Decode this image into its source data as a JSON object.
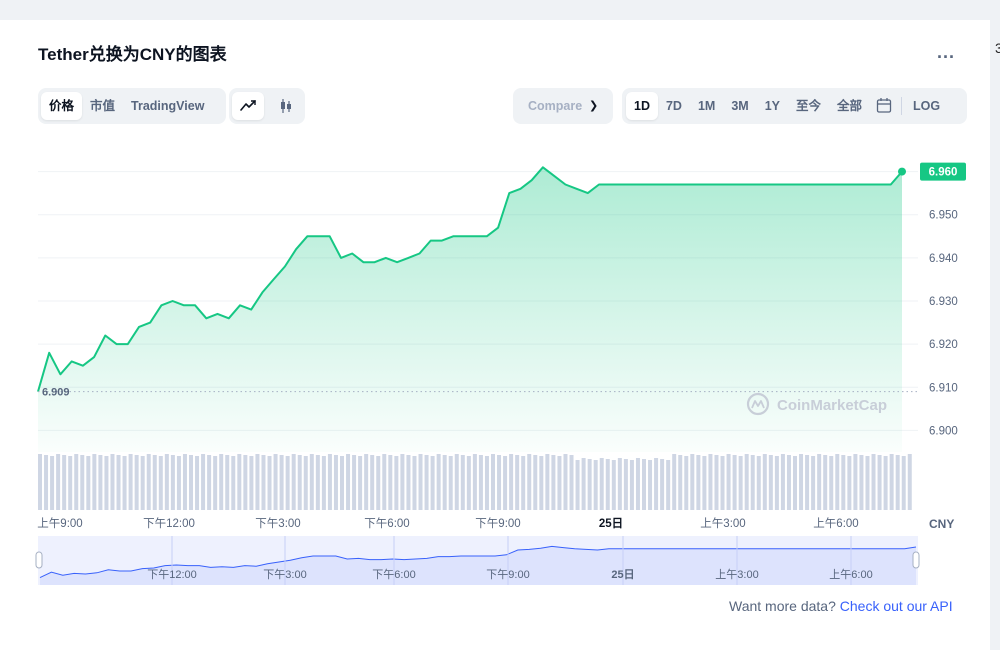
{
  "header": {
    "title": "Tether兑换为CNY的图表",
    "more_label": "...",
    "edge_label": "3"
  },
  "toolbar": {
    "view_tabs": [
      "价格",
      "市值",
      "TradingView"
    ],
    "chart_type": [
      "line-chart-icon",
      "candlestick-icon"
    ],
    "compare_label": "Compare",
    "ranges": [
      "1D",
      "7D",
      "1M",
      "3M",
      "1Y",
      "至今",
      "全部"
    ],
    "calendar_icon": "calendar-icon",
    "log_label": "LOG"
  },
  "watermark": "CoinMarketCap",
  "footer": {
    "prefix": "Want more data? ",
    "link": "Check out our API"
  },
  "colors": {
    "line": "#16c784",
    "fill": "#16c784",
    "volume": "#cfd6e4",
    "navigator_fill": "#dde3fd",
    "navigator_line": "#3861fb"
  },
  "chart_data": {
    "type": "area",
    "title": "Tether兑换为CNY的图表",
    "xlabel": "",
    "ylabel": "",
    "currency_label": "CNY",
    "ylim": [
      6.895,
      6.965
    ],
    "yticks": [
      "6.900",
      "6.910",
      "6.920",
      "6.930",
      "6.940",
      "6.950",
      "6.960"
    ],
    "current_value": "6.960",
    "start_value": "6.909",
    "xticks": [
      "上午9:00",
      "下午12:00",
      "下午3:00",
      "下午6:00",
      "下午9:00",
      "25日",
      "上午3:00",
      "上午6:00"
    ],
    "navigator_xticks": [
      "下午12:00",
      "下午3:00",
      "下午6:00",
      "下午9:00",
      "25日",
      "上午3:00",
      "上午6:00"
    ],
    "series": [
      {
        "x": [
          "09:00",
          "09:15",
          "09:30",
          "09:45",
          "10:00",
          "10:15",
          "10:30",
          "10:45",
          "11:00",
          "11:15",
          "11:30",
          "11:45",
          "12:00",
          "12:15",
          "12:30",
          "12:45",
          "13:00",
          "13:15",
          "13:30",
          "13:45",
          "14:00",
          "14:15",
          "14:30",
          "14:45",
          "15:00",
          "15:15",
          "15:30",
          "15:45",
          "16:00",
          "16:15",
          "16:30",
          "16:45",
          "17:00",
          "17:15",
          "17:30",
          "17:45",
          "18:00",
          "18:15",
          "18:30",
          "18:45",
          "19:00",
          "19:15",
          "19:30",
          "19:45",
          "20:00",
          "20:15",
          "20:30",
          "20:45",
          "21:00",
          "21:15",
          "21:30",
          "21:45",
          "22:00",
          "22:15",
          "22:30",
          "22:45",
          "23:00",
          "23:15",
          "23:30",
          "23:45",
          "00:00",
          "00:30",
          "01:00",
          "01:30",
          "02:00",
          "02:30",
          "03:00",
          "03:30",
          "04:00",
          "04:30",
          "05:00",
          "05:30",
          "06:00",
          "06:30",
          "07:00",
          "07:15",
          "07:30",
          "07:45"
        ],
        "values": [
          6.909,
          6.918,
          6.913,
          6.916,
          6.915,
          6.917,
          6.922,
          6.92,
          6.92,
          6.924,
          6.925,
          6.929,
          6.93,
          6.929,
          6.929,
          6.926,
          6.927,
          6.926,
          6.929,
          6.928,
          6.932,
          6.935,
          6.938,
          6.942,
          6.945,
          6.945,
          6.945,
          6.94,
          6.941,
          6.939,
          6.939,
          6.94,
          6.939,
          6.94,
          6.941,
          6.944,
          6.944,
          6.945,
          6.945,
          6.945,
          6.945,
          6.947,
          6.955,
          6.956,
          6.958,
          6.961,
          6.959,
          6.957,
          6.956,
          6.955,
          6.957,
          6.957,
          6.957,
          6.957,
          6.957,
          6.957,
          6.957,
          6.957,
          6.957,
          6.957,
          6.957,
          6.957,
          6.957,
          6.957,
          6.957,
          6.957,
          6.957,
          6.957,
          6.957,
          6.957,
          6.957,
          6.957,
          6.957,
          6.957,
          6.957,
          6.957,
          6.957,
          6.96
        ]
      }
    ]
  }
}
